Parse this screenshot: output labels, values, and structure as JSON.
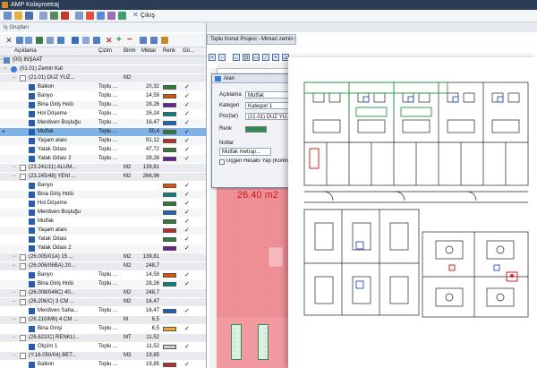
{
  "window": {
    "title": "AMP Kolaymetraj"
  },
  "menubar": {
    "exit_label": "Çıkış"
  },
  "left_panel": {
    "title": "İş Grupları",
    "columns": {
      "aciklama": "Açıklama",
      "cizim": "Çizim",
      "birim": "Birim",
      "miktar": "Miktar",
      "renk": "Renk",
      "gorunur": "Gö..."
    }
  },
  "tree_rows": [
    {
      "name": "(00) İNŞAAT",
      "cizim": "",
      "birim": "",
      "miktar": "",
      "color": "",
      "check": false,
      "level": 0,
      "icon": "grid",
      "type": "grp"
    },
    {
      "name": "(01.01) Zemin Kat",
      "cizim": "",
      "birim": "",
      "miktar": "",
      "color": "",
      "check": false,
      "level": 1,
      "icon": "glob",
      "type": "grp"
    },
    {
      "name": "(21.01) DÜZ YÜZ...",
      "cizim": "",
      "birim": "M2",
      "miktar": "",
      "color": "",
      "check": false,
      "level": 2,
      "icon": "list",
      "type": "grp"
    },
    {
      "name": "Balkon",
      "cizim": "Toplu ...",
      "birim": "",
      "miktar": "20,32",
      "color": "#2e7d32",
      "check": true,
      "level": 3,
      "icon": "doc",
      "type": "item"
    },
    {
      "name": "Banyo",
      "cizim": "Toplu ...",
      "birim": "",
      "miktar": "14,59",
      "color": "#e65100",
      "check": true,
      "level": 3,
      "icon": "doc",
      "type": "item"
    },
    {
      "name": "Bina Giriş Holü",
      "cizim": "Toplu ...",
      "birim": "",
      "miktar": "28,26",
      "color": "#6a1b9a",
      "check": true,
      "level": 3,
      "icon": "doc",
      "type": "item"
    },
    {
      "name": "Hol Döşeme",
      "cizim": "Toplu ...",
      "birim": "",
      "miktar": "26,24",
      "color": "#00897b",
      "check": true,
      "level": 3,
      "icon": "doc",
      "type": "item"
    },
    {
      "name": "Merdiven Boşluğu",
      "cizim": "Toplu ...",
      "birim": "",
      "miktar": "16,47",
      "color": "#1565c0",
      "check": true,
      "level": 3,
      "icon": "doc",
      "type": "item"
    },
    {
      "name": "Mutfak",
      "cizim": "Toplu ...",
      "birim": "",
      "miktar": "50,4",
      "color": "#2e7d32",
      "check": true,
      "level": 3,
      "icon": "doc",
      "type": "sel"
    },
    {
      "name": "Yaşam alanı",
      "cizim": "Toplu ...",
      "birim": "",
      "miktar": "91,12",
      "color": "#c62828",
      "check": true,
      "level": 3,
      "icon": "doc",
      "type": "item"
    },
    {
      "name": "Yatak Odası",
      "cizim": "Toplu ...",
      "birim": "",
      "miktar": "47,72",
      "color": "#2e7d32",
      "check": true,
      "level": 3,
      "icon": "doc",
      "type": "item"
    },
    {
      "name": "Yatak Odası 2",
      "cizim": "Toplu ...",
      "birim": "",
      "miktar": "28,26",
      "color": "#6a1b9a",
      "check": true,
      "level": 3,
      "icon": "doc",
      "type": "item"
    },
    {
      "name": "(23.241/11) ALUM...",
      "cizim": "",
      "birim": "M2",
      "miktar": "139,81",
      "color": "",
      "check": false,
      "level": 2,
      "icon": "list",
      "type": "grp"
    },
    {
      "name": "(23.245/48) YENİ ...",
      "cizim": "",
      "birim": "M2",
      "miktar": "266,96",
      "color": "",
      "check": false,
      "level": 2,
      "icon": "list",
      "type": "grp"
    },
    {
      "name": "Banyo",
      "cizim": "",
      "birim": "",
      "miktar": "",
      "color": "#e65100",
      "check": true,
      "level": 3,
      "icon": "doc",
      "type": "item"
    },
    {
      "name": "Bina Giriş Holü",
      "cizim": "",
      "birim": "",
      "miktar": "",
      "color": "#00897b",
      "check": true,
      "level": 3,
      "icon": "doc",
      "type": "item"
    },
    {
      "name": "Hol Döşeme",
      "cizim": "",
      "birim": "",
      "miktar": "",
      "color": "#2e7d32",
      "check": true,
      "level": 3,
      "icon": "doc",
      "type": "item"
    },
    {
      "name": "Merdiven Boşluğu",
      "cizim": "",
      "birim": "",
      "miktar": "",
      "color": "#1565c0",
      "check": true,
      "level": 3,
      "icon": "doc",
      "type": "item"
    },
    {
      "name": "Mutfak",
      "cizim": "",
      "birim": "",
      "miktar": "",
      "color": "#2e7d32",
      "check": true,
      "level": 3,
      "icon": "doc",
      "type": "item"
    },
    {
      "name": "Yaşam alanı",
      "cizim": "",
      "birim": "",
      "miktar": "",
      "color": "#c62828",
      "check": true,
      "level": 3,
      "icon": "doc",
      "type": "item"
    },
    {
      "name": "Yatak Odası",
      "cizim": "",
      "birim": "",
      "miktar": "",
      "color": "#2e7d32",
      "check": true,
      "level": 3,
      "icon": "doc",
      "type": "item"
    },
    {
      "name": "Yatak Odası 2",
      "cizim": "",
      "birim": "",
      "miktar": "",
      "color": "#6a1b9a",
      "check": true,
      "level": 3,
      "icon": "doc",
      "type": "item"
    },
    {
      "name": "(26.005/01A) 15 ...",
      "cizim": "",
      "birim": "M2",
      "miktar": "139,81",
      "color": "",
      "check": false,
      "level": 2,
      "icon": "list",
      "type": "grp"
    },
    {
      "name": "(26.006/06BA) 20...",
      "cizim": "",
      "birim": "M2",
      "miktar": "248,7",
      "color": "",
      "check": false,
      "level": 2,
      "icon": "list",
      "type": "grp"
    },
    {
      "name": "Banyo",
      "cizim": "Toplu ...",
      "birim": "",
      "miktar": "14,59",
      "color": "#e65100",
      "check": true,
      "level": 3,
      "icon": "doc",
      "type": "item"
    },
    {
      "name": "Bina Giriş Holü",
      "cizim": "Toplu ...",
      "birim": "",
      "miktar": "28,26",
      "color": "#00897b",
      "check": true,
      "level": 3,
      "icon": "doc",
      "type": "item"
    },
    {
      "name": "(26.008/046C) 40...",
      "cizim": "",
      "birim": "M2",
      "miktar": "248,7",
      "color": "",
      "check": false,
      "level": 2,
      "icon": "list",
      "type": "grp"
    },
    {
      "name": "(26.206/C) 3 CM ...",
      "cizim": "",
      "birim": "M2",
      "miktar": "16,47",
      "color": "",
      "check": false,
      "level": 2,
      "icon": "list",
      "type": "grp"
    },
    {
      "name": "Merdiven Saha...",
      "cizim": "Toplu ...",
      "birim": "",
      "miktar": "16,47",
      "color": "#1565c0",
      "check": true,
      "level": 3,
      "icon": "doc",
      "type": "item"
    },
    {
      "name": "(26.210/M6) 4 CM ...",
      "cizim": "",
      "birim": "M",
      "miktar": "6,5",
      "color": "",
      "check": false,
      "level": 2,
      "icon": "list",
      "type": "grp"
    },
    {
      "name": "Bina Girişi",
      "cizim": "Toplu ...",
      "birim": "",
      "miktar": "6,5",
      "color": "#f9a825",
      "check": true,
      "level": 3,
      "icon": "doc",
      "type": "item"
    },
    {
      "name": "(26.622/C) RENKLI...",
      "cizim": "",
      "birim": "MT",
      "miktar": "11,52",
      "color": "",
      "check": false,
      "level": 2,
      "icon": "list",
      "type": "grp"
    },
    {
      "name": "Ölçüm 1",
      "cizim": "Toplu ...",
      "birim": "",
      "miktar": "11,52",
      "color": "#d7ccc8",
      "check": true,
      "level": 3,
      "icon": "doc",
      "type": "item"
    },
    {
      "name": "(Y.16.050/04) BET...",
      "cizim": "",
      "birim": "M3",
      "miktar": "19,85",
      "color": "",
      "check": false,
      "level": 2,
      "icon": "list",
      "type": "grp"
    },
    {
      "name": "Balkon",
      "cizim": "Toplu ...",
      "birim": "",
      "miktar": "19,85",
      "color": "#c62828",
      "check": true,
      "level": 3,
      "icon": "doc",
      "type": "item"
    }
  ],
  "canvas": {
    "tab_title": "Toplu Konut Projesi - Mimari zemin kat",
    "area_label": "26.40 m2"
  },
  "dialog": {
    "title": "Alan",
    "aciklama_label": "Açıklama",
    "aciklama_value": "Mutfak",
    "kategori_label": "Kategori",
    "kategori_value": "Kategori 1",
    "poz_label": "Poz(lar)",
    "poz_value": "(21.01) DÜZ YÜ...",
    "renk_label": "Renk",
    "renk_color": "#2e8b57",
    "notlar_label": "Notlar",
    "notlar_value": "Mutfak metrajı...",
    "checkbox_label": "Üçgen Hesabı Yap (Kontrol)"
  }
}
